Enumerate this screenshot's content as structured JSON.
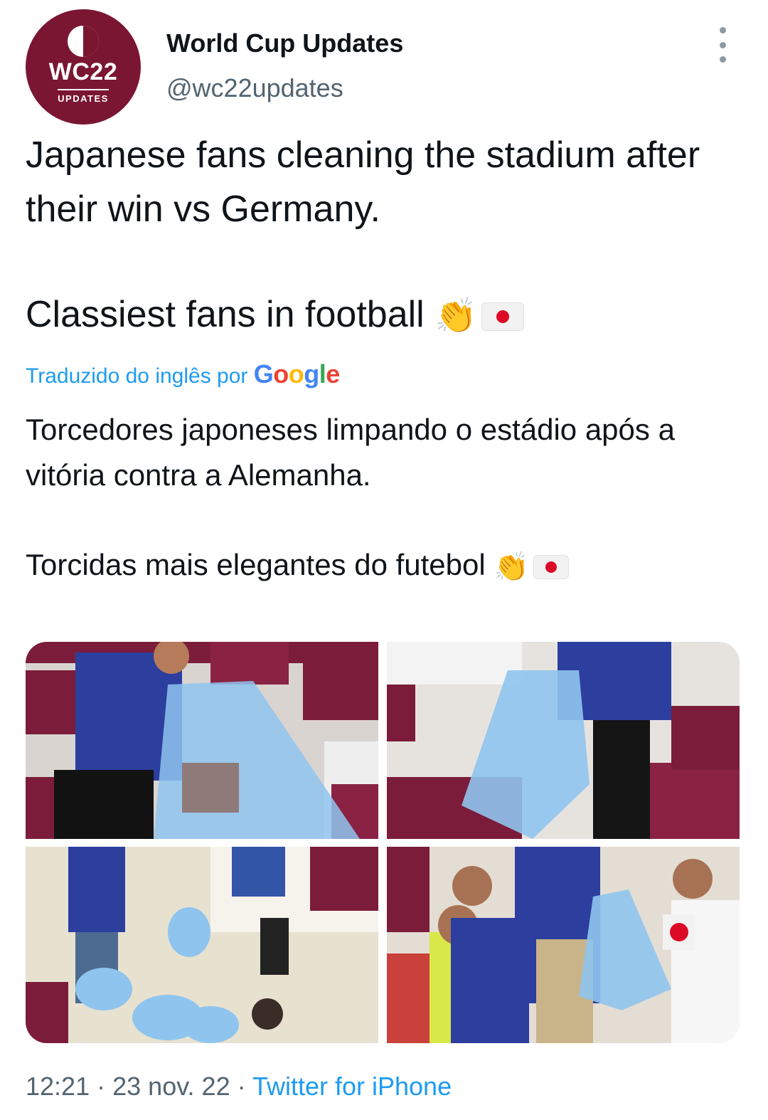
{
  "account": {
    "avatar_text": "WC22",
    "avatar_subtext": "UPDATES",
    "display_name": "World Cup Updates",
    "handle": "@wc22updates"
  },
  "tweet": {
    "line1": "Japanese fans cleaning the stadium after their win vs Germany.",
    "line2": "Classiest fans in football",
    "emoji": [
      "clapping-hands",
      "flag-japan"
    ]
  },
  "translation": {
    "label": "Traduzido do inglês por",
    "provider_letters": [
      "G",
      "o",
      "o",
      "g",
      "l",
      "e"
    ],
    "line1": "Torcedores japoneses limpando o estádio após a vitória contra a Alemanha.",
    "line2": "Torcidas mais elegantes do futebol"
  },
  "media": {
    "count": 4,
    "description": [
      "fan-with-trash-bag",
      "fan-holding-trash-bag",
      "fans-collecting-trash-in-stands",
      "fans-walking-with-trash-bag"
    ]
  },
  "footer": {
    "time": "12:21",
    "date": "23 nov. 22",
    "separator": "·",
    "source": "Twitter for iPhone"
  },
  "colors": {
    "avatar_bg": "#7a1631",
    "link": "#1d9bf0",
    "secondary_text": "#536471",
    "seat_maroon": "#7b1d3a",
    "jersey_blue": "#2c3e9e",
    "bag_blue": "#8fc4ee"
  }
}
